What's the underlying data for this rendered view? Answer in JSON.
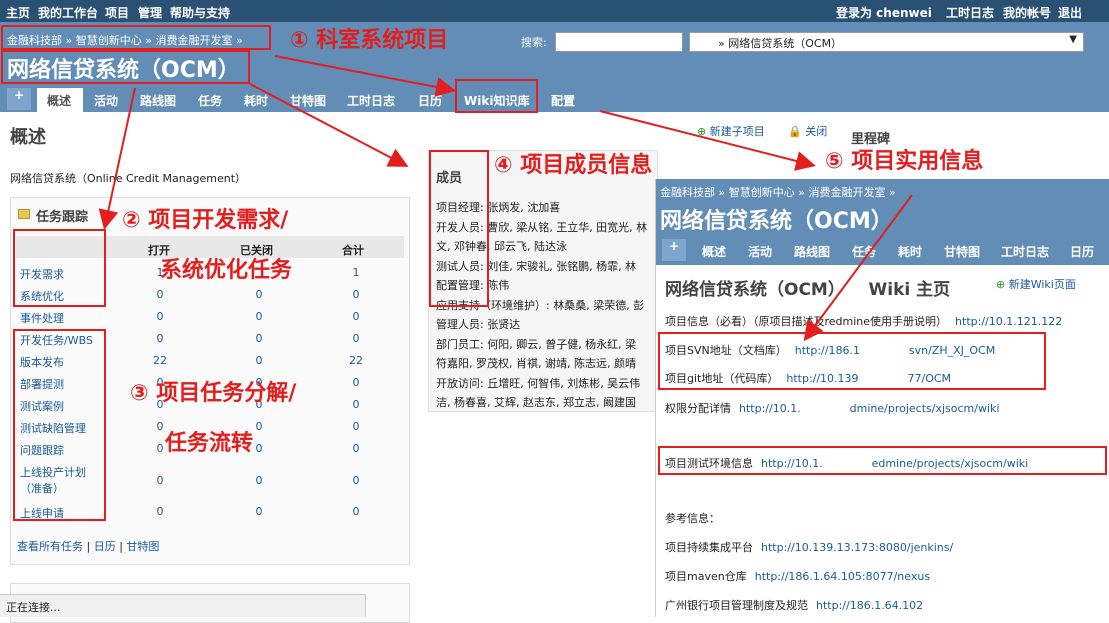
{
  "topnav": {
    "home": "主页",
    "mypage": "我的工作台",
    "projects": "项目",
    "admin": "管理",
    "help": "帮助与支持",
    "logged_in": "登录为 chenwei",
    "timelog": "工时日志",
    "account": "我的帐号",
    "logout": "退出"
  },
  "breadcrumb": "金融科技部 » 智慧创新中心 » 消费金融开发室 »",
  "project_title": "网络信贷系统（OCM）",
  "search": {
    "label": "搜索:",
    "value": ""
  },
  "project_jump": "» 网络信贷系统（OCM）",
  "tabs": [
    "概述",
    "活动",
    "路线图",
    "任务",
    "耗时",
    "甘特图",
    "工时日志",
    "日历",
    "Wiki知识库",
    "配置"
  ],
  "overview": {
    "heading": "概述",
    "new_subproject": "新建子项目",
    "close": "关闭",
    "milestones": "里程碑",
    "description": "网络信贷系统（Online Credit Management）"
  },
  "issues": {
    "title": "任务跟踪",
    "col_open": "打开",
    "col_closed": "已关闭",
    "col_total": "合计",
    "rows": [
      {
        "name": "开发需求",
        "open": "1",
        "closed": "",
        "total": "1"
      },
      {
        "name": "系统优化",
        "open": "0",
        "closed": "0",
        "total": "0"
      },
      {
        "name": "事件处理",
        "open": "0",
        "closed": "0",
        "total": "0"
      },
      {
        "name": "开发任务/WBS",
        "open": "0",
        "closed": "0",
        "total": "0"
      },
      {
        "name": "版本发布",
        "open": "22",
        "closed": "0",
        "total": "22"
      },
      {
        "name": "部署提测",
        "open": "0",
        "closed": "0",
        "total": "0"
      },
      {
        "name": "测试案例",
        "open": "0",
        "closed": "0",
        "total": "0"
      },
      {
        "name": "测试缺陷管理",
        "open": "0",
        "closed": "0",
        "total": "0"
      },
      {
        "name": "问题跟踪",
        "open": "0",
        "closed": "0",
        "total": "0"
      },
      {
        "name": "上线投产计划（准备）",
        "open": "0",
        "closed": "0",
        "total": "0"
      },
      {
        "name": "上线申请",
        "open": "0",
        "closed": "0",
        "total": "0"
      }
    ],
    "links": [
      "查看所有任务",
      "日历",
      "甘特图"
    ]
  },
  "members": {
    "title": "成员",
    "lines": [
      "项目经理: 张炳发, 沈加喜",
      "开发人员: 曹欣, 梁从铭, 王立华, 田宽光, 林",
      "文, 邓钟春, 邱云飞, 陆达泳",
      "测试人员: 刘佳, 宋骏礼, 张铭鹏, 杨霏, 林",
      "配置管理: 陈伟",
      "应用支持（环境维护）: 林桑桑, 梁荣德, 彭",
      "管理人员: 张贤达",
      "部门员工: 何阳, 卿云, 曾子健, 杨永红, 梁",
      "符嘉阳, 罗茂权, 肖祺, 谢靖, 陈志远, 颜晴",
      "开放访问: 丘增旺, 何智伟, 刘炼彬, 吴云伟",
      "洁, 杨春喜, 艾辉, 赵志东, 郑立志, 阚建国"
    ]
  },
  "wiki": {
    "breadcrumb": "金融科技部 » 智慧创新中心 » 消费金融开发室 »",
    "title": "网络信贷系统（OCM）",
    "tabs": [
      "概述",
      "活动",
      "路线图",
      "任务",
      "耗时",
      "甘特图",
      "工时日志",
      "日历"
    ],
    "page_title": "网络信贷系统（OCM）    Wiki 主页",
    "new_wiki": "新建Wiki页面",
    "lines": [
      {
        "label": "项目信息（必看）（原项目描述及redmine使用手册说明）",
        "url": "http://10.1.121.122"
      },
      {
        "label": "项目SVN地址（文档库）",
        "url": "http://186.1              svn/ZH_XJ_OCM"
      },
      {
        "label": "项目git地址（代码库）",
        "url": "http://10.139              77/OCM"
      },
      {
        "label": "权限分配详情",
        "url": "http://10.1.              dmine/projects/xjsocm/wiki"
      },
      {
        "label": "项目测试环境信息",
        "url": "http://10.1.              edmine/projects/xjsocm/wiki"
      },
      {
        "label": "参考信息：",
        "url": ""
      },
      {
        "label": "项目持续集成平台",
        "url": "http://10.139.13.173:8080/jenkins/"
      },
      {
        "label": "项目maven仓库",
        "url": "http://186.1.64.105:8077/nexus"
      },
      {
        "label": "广州银行项目管理制度及规范",
        "url": "http://186.1.64.102"
      }
    ]
  },
  "annotations": [
    "① 科室系统项目",
    "② 项目开发需求/",
    "系统优化任务",
    "③ 项目任务分解/",
    "任务流转",
    "④ 项目成员信息",
    "⑤ 项目实用信息"
  ],
  "status": "正在连接...",
  "colors": {
    "header": "#628db6",
    "topbar": "#2a5074",
    "annotation": "#e21e1e"
  }
}
